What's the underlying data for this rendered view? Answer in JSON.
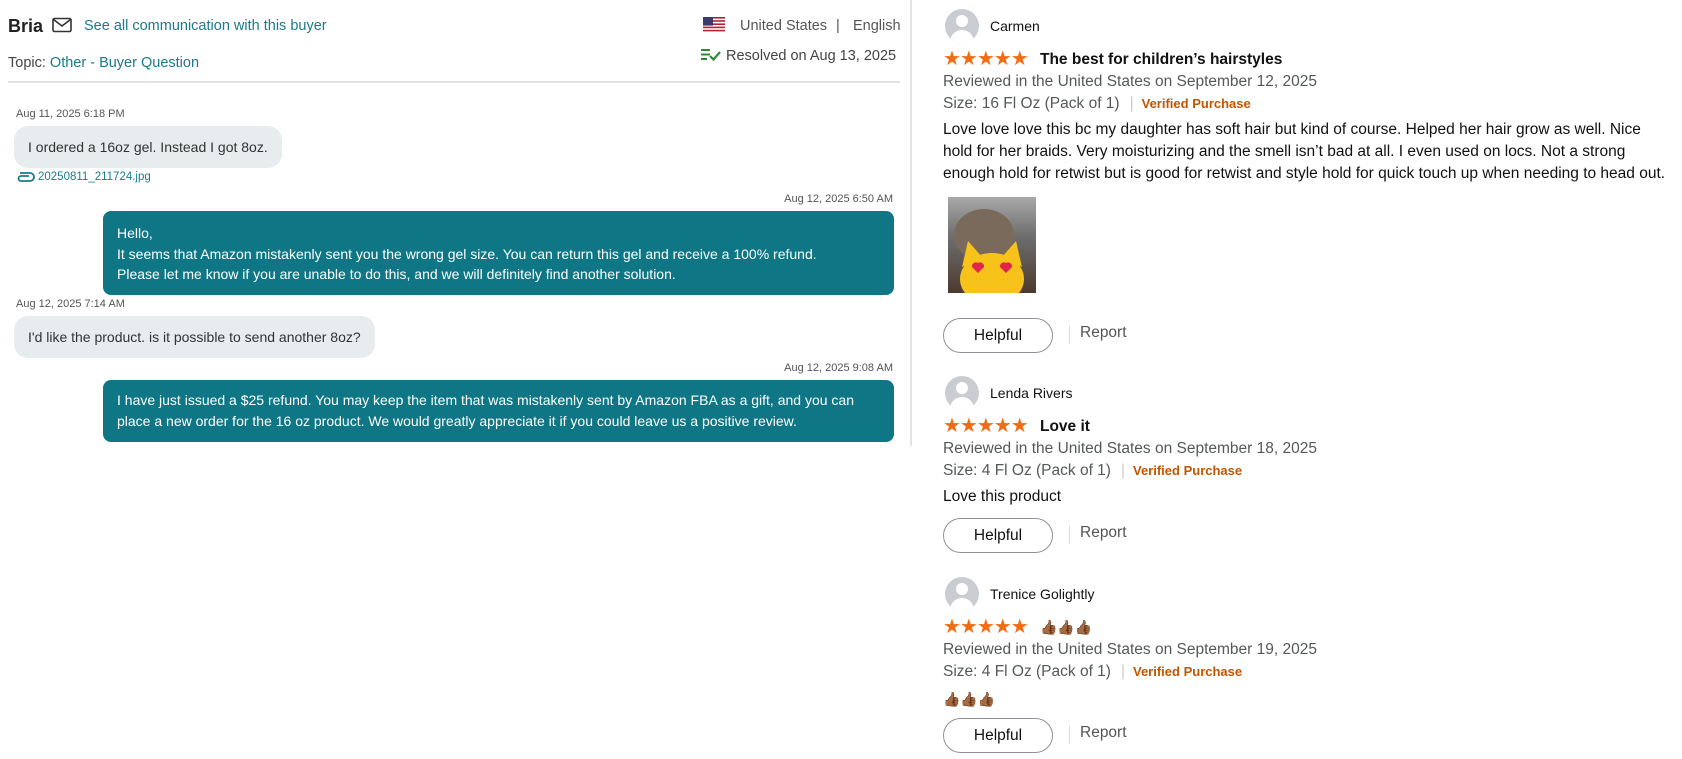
{
  "thread": {
    "buyer_name": "Bria",
    "see_all_link": "See all communication with this buyer",
    "country": "United States",
    "separator": "|",
    "language": "English",
    "topic_label": "Topic:",
    "topic_value": "Other - Buyer Question",
    "resolved": "Resolved on Aug 13, 2025",
    "messages": [
      {
        "time": "Aug 11, 2025 6:18 PM",
        "lines": [
          "I ordered a 16oz gel. Instead I got 8oz."
        ],
        "attachment": "20250811_211724.jpg"
      },
      {
        "time": "Aug 12, 2025 6:50 AM",
        "lines": [
          "Hello,",
          "It seems that Amazon mistakenly sent you the wrong gel size. You can return this gel and receive a 100% refund.",
          "Please let me know if you are unable to do this, and we will definitely find another solution."
        ]
      },
      {
        "time": "Aug 12, 2025 7:14 AM",
        "lines": [
          "I'd like the product. is it possible to send another 8oz?"
        ]
      },
      {
        "time": "Aug 12, 2025 9:08 AM",
        "lines": [
          "I have just issued a $25 refund. You may keep the item that was mistakenly sent by Amazon FBA as a gift, and you can",
          "place a new order for the 16 oz product. We would greatly appreciate it if you could leave us a positive review."
        ]
      }
    ]
  },
  "reviews": [
    {
      "name": "Carmen",
      "rating": 5,
      "stars": "★★★★★",
      "title": "The best for children’s hairstyles",
      "meta": "Reviewed in the United States on September 12, 2025",
      "size": "Size: 16 Fl Oz (Pack of 1)",
      "verified": "Verified Purchase",
      "body": "Love love love this bc my daughter has soft hair but kind of course. Helped her hair grow as well. Nice hold for her braids. Very moisturizing and the smell isn’t bad at all. I even used on locs. Not a strong enough hold for retwist but is good for retwist and style hold for quick touch up when needing to head out.",
      "helpful": "Helpful",
      "report": "Report"
    },
    {
      "name": "Lenda Rivers",
      "rating": 5,
      "stars": "★★★★★",
      "title": "Love it",
      "meta": "Reviewed in the United States on September 18, 2025",
      "size": "Size: 4 Fl Oz (Pack of 1)",
      "verified": "Verified Purchase",
      "body": "Love this product",
      "helpful": "Helpful",
      "report": "Report"
    },
    {
      "name": "Trenice Golightly",
      "rating": 5,
      "stars": "★★★★★",
      "title": "👍🏾👍🏾👍🏾",
      "meta": "Reviewed in the United States on September 19, 2025",
      "size": "Size: 4 Fl Oz (Pack of 1)",
      "verified": "Verified Purchase",
      "body": "👍🏾👍🏾👍🏾",
      "helpful": "Helpful",
      "report": "Report"
    }
  ],
  "colors": {
    "accent": "#0e7684",
    "link": "#1a7a8c",
    "star": "#f26c13",
    "verified": "#c45500"
  }
}
